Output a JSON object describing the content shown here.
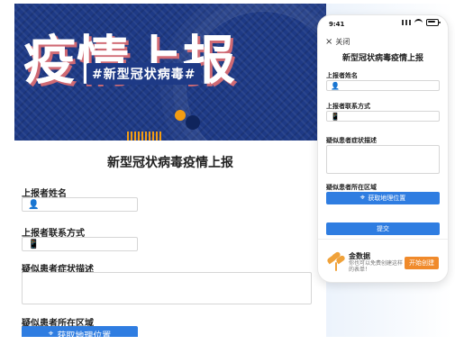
{
  "banner": {
    "big_text": "疫情上报",
    "sub_text": "#新型冠状病毒#"
  },
  "desktop_form": {
    "title": "新型冠状病毒疫情上报",
    "fields": [
      {
        "label": "上报者姓名",
        "icon": "person-icon"
      },
      {
        "label": "上报者联系方式",
        "icon": "phone-icon"
      },
      {
        "label": "疑似患者症状描述"
      },
      {
        "label": "疑似患者所在区域"
      }
    ],
    "location_button": "获取地理位置"
  },
  "phone": {
    "time": "9:41",
    "close_label": "关闭",
    "title": "新型冠状病毒疫情上报",
    "fields": [
      {
        "label": "上报者姓名",
        "icon": "person-icon"
      },
      {
        "label": "上报者联系方式",
        "icon": "phone-icon"
      },
      {
        "label": "疑似患者症状描述"
      },
      {
        "label": "疑似患者所在区域"
      }
    ],
    "location_button": "获取地理位置",
    "submit_button": "提交",
    "promo": {
      "brand": "金数据",
      "text": "你也可以免费创建这样的表单！",
      "open_button": "开始创建"
    }
  },
  "colors": {
    "primary_blue": "#2f7de1",
    "banner_blue": "#1e3a86",
    "accent_orange": "#f08a2b"
  }
}
